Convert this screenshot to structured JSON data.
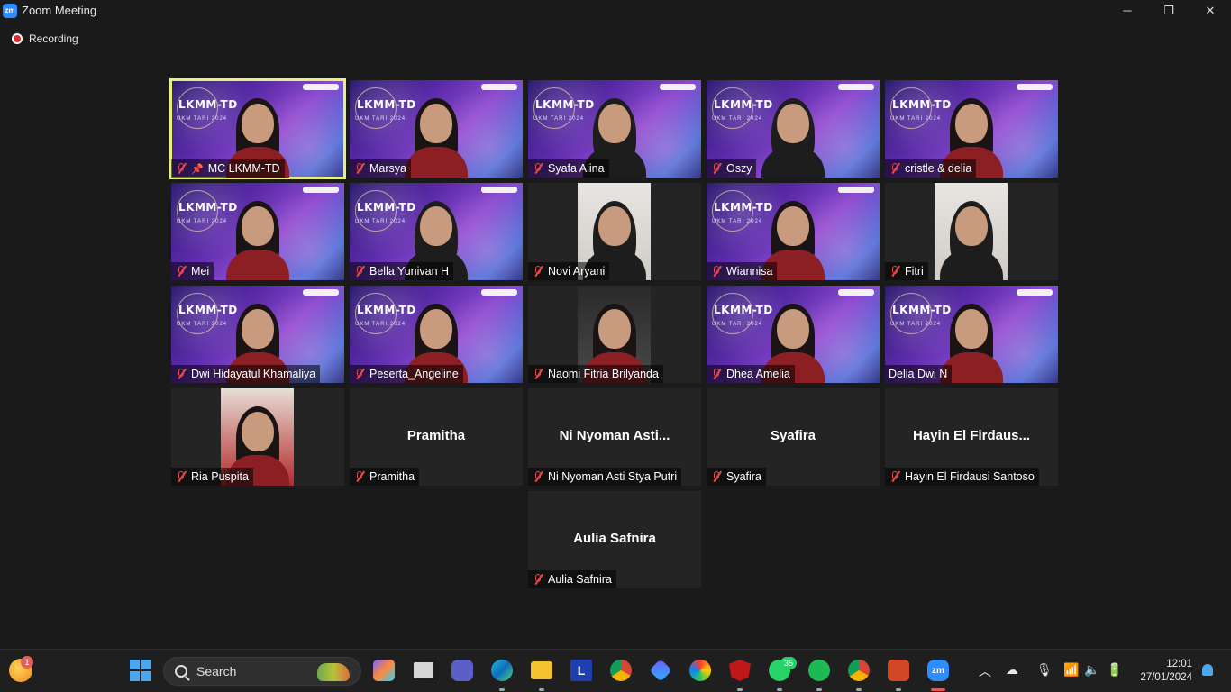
{
  "window": {
    "title": "Zoom Meeting",
    "app_icon_label": "zm",
    "controls": {
      "minimize": "─",
      "maximize": "❐",
      "close": "✕"
    }
  },
  "recording": {
    "label": "Recording"
  },
  "virtual_background": {
    "logo": "LKMM-TD",
    "subtitle": "UKM TARI 2024"
  },
  "participants": [
    {
      "name": "MC LKMM-TD",
      "type": "bg",
      "muted": true,
      "pinned": true,
      "active": true
    },
    {
      "name": "Marsya",
      "type": "bg",
      "muted": true
    },
    {
      "name": "Syafa Alina",
      "type": "bg",
      "muted": true,
      "hijab": true
    },
    {
      "name": "Oszy",
      "type": "bg",
      "muted": true,
      "hijab": true
    },
    {
      "name": "cristle & delia",
      "type": "bg",
      "muted": true
    },
    {
      "name": "Mei",
      "type": "bg",
      "muted": true
    },
    {
      "name": "Bella Yunivan H",
      "type": "bg",
      "muted": true,
      "hijab": true
    },
    {
      "name": "Novi Aryani",
      "type": "cam",
      "muted": true,
      "hijab": true
    },
    {
      "name": "Wiannisa",
      "type": "bg",
      "muted": true
    },
    {
      "name": "Fitri",
      "type": "cam",
      "muted": true,
      "hijab": true
    },
    {
      "name": "Dwi Hidayatul Khamaliya",
      "type": "bg",
      "muted": true
    },
    {
      "name": "Peserta_Angeline",
      "type": "bg",
      "muted": true
    },
    {
      "name": "Naomi Fitria Brilyanda",
      "type": "cam-dark",
      "muted": true
    },
    {
      "name": "Dhea Amelia",
      "type": "bg",
      "muted": true
    },
    {
      "name": "Delia Dwi N",
      "type": "bg",
      "muted": false,
      "speaking": true
    },
    {
      "name": "Ria Puspita",
      "type": "cam-red",
      "muted": true
    },
    {
      "name": "Pramitha",
      "type": "off",
      "muted": true,
      "display": "Pramitha"
    },
    {
      "name": "Ni Nyoman Asti Stya Putri",
      "type": "off",
      "muted": true,
      "display": "Ni Nyoman Asti..."
    },
    {
      "name": "Syafira",
      "type": "off",
      "muted": true,
      "display": "Syafira"
    },
    {
      "name": "Hayin El Firdausi Santoso",
      "type": "off",
      "muted": true,
      "display": "Hayin El Firdaus..."
    },
    {
      "name": "Aulia Safnira",
      "type": "off",
      "muted": true,
      "display": "Aulia Safnira"
    }
  ],
  "taskbar": {
    "search_label": "Search",
    "weather_badge": "1",
    "whatsapp_badge": "35",
    "time": "12:01",
    "date": "27/01/2024",
    "icons": [
      "copilot-icon",
      "task-view-icon",
      "meet-icon",
      "edge-icon",
      "file-explorer-icon",
      "l-app-icon",
      "chrome-icon",
      "vpn-icon",
      "browser-icon",
      "mcafee-icon",
      "whatsapp-icon",
      "spotify-icon",
      "chrome-profile-icon",
      "powerpoint-icon",
      "zoom-icon"
    ],
    "colors": {
      "accent": "#2d8cff",
      "taskbar": "#1f1f1f",
      "whatsapp": "#25d366",
      "spotify": "#1db954"
    }
  }
}
